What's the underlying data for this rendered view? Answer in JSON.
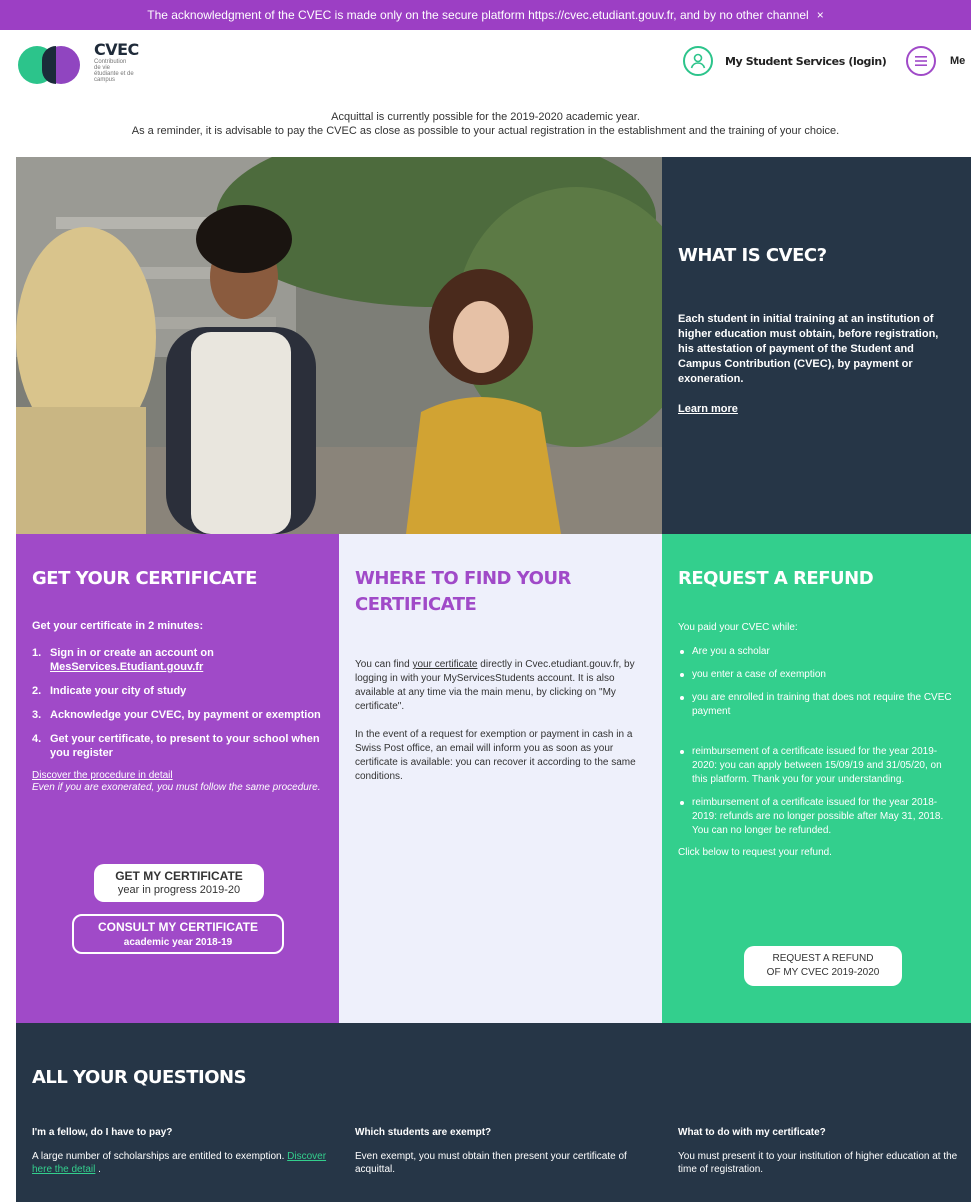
{
  "banner": {
    "text": "The acknowledgment of the CVEC is made only on the secure platform https://cvec.etudiant.gouv.fr, and by no other channel",
    "close": "×"
  },
  "header": {
    "brand": "CVEC",
    "brand_sub": "Contribution de vie étudiante et de campus",
    "login_label": "My Student Services (login)",
    "menu_label": "Me"
  },
  "notice": {
    "line1": "Acquittal is currently possible for the 2019-2020 academic year.",
    "line2": "As a reminder, it is advisable to pay the CVEC as close as possible to your actual registration in the establishment and the training of your choice."
  },
  "what": {
    "title": "WHAT IS CVEC?",
    "body": "Each student in initial training at an institution of higher education must obtain, before registration, his attestation of payment of the Student and Campus Contribution (CVEC), by payment or exoneration.",
    "link": "Learn more"
  },
  "get": {
    "title": "GET YOUR CERTIFICATE",
    "intro": "Get your certificate in 2 minutes:",
    "steps": [
      {
        "n": "1.",
        "pre": "Sign in or create an account on",
        "link": "MesServices.Etudiant.gouv.fr"
      },
      {
        "n": "2.",
        "text": "Indicate your city of study"
      },
      {
        "n": "3.",
        "text": "Acknowledge your CVEC, by payment or exemption"
      },
      {
        "n": "4.",
        "text": "Get your certificate, to present to your school when you register"
      }
    ],
    "detail_link": "Discover the procedure in detail",
    "note": "Even if you are exonerated, you must follow the same procedure.",
    "btn1_line1": "GET MY CERTIFICATE",
    "btn1_line2": "year in progress 2019-20",
    "btn2_line1": "CONSULT MY CERTIFICATE",
    "btn2_line2": "academic year 2018-19"
  },
  "where": {
    "title": "WHERE TO FIND YOUR CERTIFICATE",
    "p1_pre": "You can find",
    "p1_link": "your certificate",
    "p1_post": "directly in Cvec.etudiant.gouv.fr, by logging in with your MyServicesStudents account. It is also available at any time via the main menu, by clicking on \"My certificate\".",
    "p2": "In the event of a request for exemption or payment in cash in a Swiss Post office, an email will inform you as soon as your certificate is available: you can recover it according to the same conditions."
  },
  "refund": {
    "title": "REQUEST A REFUND",
    "intro": "You paid your CVEC while:",
    "items": [
      "Are you a scholar",
      "you enter a case of exemption",
      "you are enrolled in training that does not require the CVEC payment",
      "reimbursement of a certificate issued for the year 2019-2020: you can apply between 15/09/19 and 31/05/20, on this platform. Thank you for your understanding.",
      "reimbursement of a certificate issued for the year 2018-2019: refunds are no longer possible after May 31, 2018. You can no longer be refunded."
    ],
    "click": "Click below to request your refund.",
    "btn_line1": "REQUEST A REFUND",
    "btn_line2": "OF MY CVEC 2019-2020"
  },
  "faq": {
    "title": "ALL YOUR QUESTIONS",
    "q1_title": "I'm a fellow, do I have to pay?",
    "q1_body": "A large number of scholarships are entitled to exemption.",
    "q1_link": "Discover here the detail",
    "q1_end": ".",
    "q2_title": "Which students are exempt?",
    "q2_body": "Even exempt, you must obtain then present your certificate of acquittal.",
    "q3_title": "What to do with my certificate?",
    "q3_body": "You must present it to your institution of higher education at the time of registration."
  }
}
